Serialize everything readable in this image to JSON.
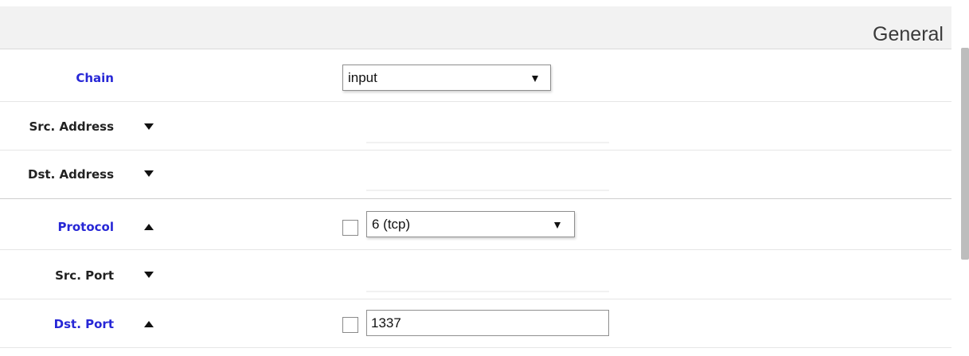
{
  "section": {
    "title": "General"
  },
  "rows": {
    "chain": {
      "label": "Chain",
      "value": "input"
    },
    "src_address": {
      "label": "Src. Address",
      "toggle_icon": "triangle-down"
    },
    "dst_address": {
      "label": "Dst. Address",
      "toggle_icon": "triangle-down"
    },
    "protocol": {
      "label": "Protocol",
      "toggle_icon": "triangle-up",
      "negate_checked": false,
      "value": "6 (tcp)"
    },
    "src_port": {
      "label": "Src. Port",
      "toggle_icon": "triangle-down"
    },
    "dst_port": {
      "label": "Dst. Port",
      "toggle_icon": "triangle-up",
      "negate_checked": false,
      "value": "1337"
    }
  },
  "colors": {
    "active_label": "#2727d6",
    "inactive_label": "#222222",
    "header_band": "#f2f2f2"
  }
}
